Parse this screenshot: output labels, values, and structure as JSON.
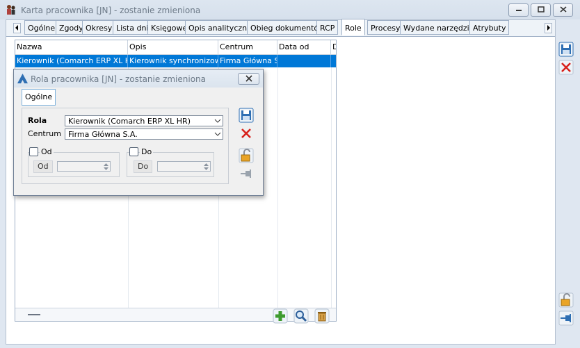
{
  "window": {
    "title": "Karta pracownika [JN] - zostanie zmieniona"
  },
  "tabs": [
    {
      "label": "Ogólne"
    },
    {
      "label": "Zgody"
    },
    {
      "label": "Okresy"
    },
    {
      "label": "Lista dni"
    },
    {
      "label": "Księgowe"
    },
    {
      "label": "Opis analityczny"
    },
    {
      "label": "Obieg dokumentów"
    },
    {
      "label": "RCP"
    },
    {
      "label": "Role"
    },
    {
      "label": "Procesy"
    },
    {
      "label": "Wydane narzędzia"
    },
    {
      "label": "Atrybuty"
    }
  ],
  "grid": {
    "columns": [
      "Nazwa",
      "Opis",
      "Centrum",
      "Data od",
      "D"
    ],
    "rows": [
      [
        "Kierownik (Comarch ERP XL HR)",
        "Kierownik synchronizowany",
        "Firma Główna S.A.",
        "",
        ""
      ]
    ]
  },
  "dialog": {
    "title": "Rola pracownika [JN] - zostanie zmieniona",
    "tab": "Ogólne",
    "rola_label": "Rola",
    "rola_value": "Kierownik (Comarch ERP XL HR)",
    "centrum_label": "Centrum",
    "centrum_value": "Firma Główna S.A.",
    "od_label": "Od",
    "od_button": "Od",
    "do_label": "Do",
    "do_button": "Do"
  },
  "colors": {
    "selection": "#0078d7",
    "accent": "#2f6fb3"
  }
}
